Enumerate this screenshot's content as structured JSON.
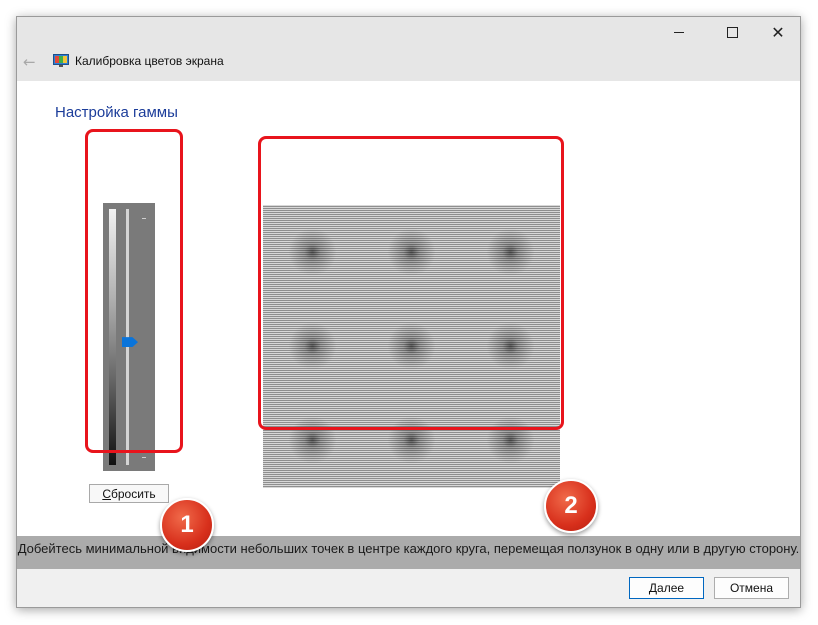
{
  "window": {
    "title": "Калибровка цветов экрана",
    "controls": {
      "minimize": "min-icon",
      "maximize": "max-icon",
      "close": "✕"
    }
  },
  "heading": "Настройка гаммы",
  "slider": {
    "value": 0.52
  },
  "reset_button": {
    "label_u": "С",
    "label_rest": "бросить"
  },
  "markers": [
    "1",
    "2"
  ],
  "instruction": "Добейтесь минимальной видимости небольших точек в центре каждого круга, перемещая ползунок в одну или в другую сторону.",
  "footer": {
    "next_u": "Д",
    "next_rest": "алее",
    "cancel": "Отмена"
  },
  "colors": {
    "heading": "#1c3d9a",
    "highlight": "#e8141c",
    "badge": "#d8301c",
    "thumb": "#0a74da"
  }
}
